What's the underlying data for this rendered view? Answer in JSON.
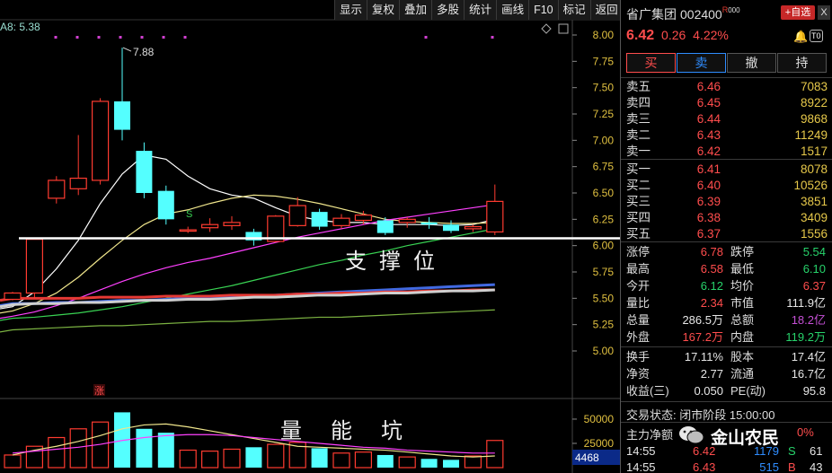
{
  "toolbar": {
    "items": [
      "显示",
      "复权",
      "叠加",
      "多股",
      "统计",
      "画线",
      "F10",
      "标记",
      "返回"
    ]
  },
  "ma_label": "A8: 5.38",
  "annotations": {
    "support": "支撑位",
    "volume_pit": "量能坑"
  },
  "stock": {
    "name": "省广集团",
    "code": "002400",
    "r_mark": "R",
    "r_code": "000",
    "select_label": "+自选",
    "close_label": "X",
    "price": "6.42",
    "change": "0.26",
    "change_pct": "4.22%",
    "t0_label": "T0"
  },
  "trade_buttons": [
    "买",
    "卖",
    "撤",
    "持"
  ],
  "asks": [
    {
      "label": "卖五",
      "price": "6.46",
      "volume": "7083"
    },
    {
      "label": "卖四",
      "price": "6.45",
      "volume": "8922"
    },
    {
      "label": "卖三",
      "price": "6.44",
      "volume": "9868"
    },
    {
      "label": "卖二",
      "price": "6.43",
      "volume": "11249"
    },
    {
      "label": "卖一",
      "price": "6.42",
      "volume": "1517"
    }
  ],
  "bids": [
    {
      "label": "买一",
      "price": "6.41",
      "volume": "8078"
    },
    {
      "label": "买二",
      "price": "6.40",
      "volume": "10526"
    },
    {
      "label": "买三",
      "price": "6.39",
      "volume": "3851"
    },
    {
      "label": "买四",
      "price": "6.38",
      "volume": "3409"
    },
    {
      "label": "买五",
      "price": "6.37",
      "volume": "1556"
    }
  ],
  "stats_a": [
    {
      "l1": "涨停",
      "v1": "6.78",
      "c1": "red",
      "l2": "跌停",
      "v2": "5.54",
      "c2": "green"
    },
    {
      "l1": "最高",
      "v1": "6.58",
      "c1": "red",
      "l2": "最低",
      "v2": "6.10",
      "c2": "green"
    },
    {
      "l1": "今开",
      "v1": "6.12",
      "c1": "green",
      "l2": "均价",
      "v2": "6.37",
      "c2": "red"
    },
    {
      "l1": "量比",
      "v1": "2.34",
      "c1": "red",
      "l2": "市值",
      "v2": "111.9亿",
      "c2": "white"
    },
    {
      "l1": "总量",
      "v1": "286.5万",
      "c1": "white",
      "l2": "总额",
      "v2": "18.2亿",
      "c2": "purple"
    },
    {
      "l1": "外盘",
      "v1": "167.2万",
      "c1": "red",
      "l2": "内盘",
      "v2": "119.2万",
      "c2": "green"
    }
  ],
  "stats_b": [
    {
      "l1": "换手",
      "v1": "17.11%",
      "c1": "white",
      "l2": "股本",
      "v2": "17.4亿",
      "c2": "white"
    },
    {
      "l1": "净资",
      "v1": "2.77",
      "c1": "white",
      "l2": "流通",
      "v2": "16.7亿",
      "c2": "white"
    },
    {
      "l1": "收益(三)",
      "v1": "0.050",
      "c1": "white",
      "l2": "PE(动)",
      "v2": "95.8",
      "c2": "white"
    }
  ],
  "trade_status": "交易状态: 闭市阶段 15:00:00",
  "main_flow": "主力净额",
  "main_flow_tail": "0%",
  "ticks": [
    {
      "time": "14:55",
      "price": "6.42",
      "vol": "1179",
      "side": "S",
      "n": "61"
    },
    {
      "time": "14:55",
      "price": "6.43",
      "vol": "515",
      "side": "B",
      "n": "43"
    }
  ],
  "watermark": "金山农民",
  "chart_data": {
    "type": "candlestick",
    "y_ticks": [
      "8.00",
      "7.75",
      "7.50",
      "7.25",
      "7.00",
      "6.75",
      "6.50",
      "6.25",
      "6.00",
      "5.75",
      "5.50",
      "5.25",
      "5.00"
    ],
    "ylim": [
      4.8,
      8.05
    ],
    "high_label": "7.88",
    "support_level": 6.07,
    "limit_up_mark": "涨",
    "s_mark": "S",
    "volume_ticks": [
      "50000",
      "25000"
    ],
    "volume_ylim": [
      0,
      62000
    ],
    "volume_current": "4468",
    "candles": [
      {
        "o": 5.49,
        "c": 5.55,
        "h": 5.56,
        "l": 5.48,
        "v": 13000
      },
      {
        "o": 5.55,
        "c": 6.06,
        "h": 6.06,
        "l": 5.5,
        "v": 22000
      },
      {
        "o": 6.45,
        "c": 6.62,
        "h": 6.66,
        "l": 6.4,
        "v": 31000
      },
      {
        "o": 6.54,
        "c": 6.64,
        "h": 7.05,
        "l": 6.48,
        "v": 40000
      },
      {
        "o": 6.62,
        "c": 7.37,
        "h": 7.4,
        "l": 6.58,
        "v": 47000
      },
      {
        "o": 7.37,
        "c": 7.1,
        "h": 7.88,
        "l": 7.0,
        "v": 57000
      },
      {
        "o": 6.9,
        "c": 6.5,
        "h": 6.98,
        "l": 6.45,
        "v": 40000
      },
      {
        "o": 6.52,
        "c": 6.25,
        "h": 6.57,
        "l": 6.2,
        "v": 36000
      },
      {
        "o": 6.14,
        "c": 6.15,
        "h": 6.18,
        "l": 6.12,
        "v": 18000
      },
      {
        "o": 6.17,
        "c": 6.2,
        "h": 6.26,
        "l": 6.13,
        "v": 17000
      },
      {
        "o": 6.19,
        "c": 6.22,
        "h": 6.28,
        "l": 6.15,
        "v": 19000
      },
      {
        "o": 6.13,
        "c": 6.05,
        "h": 6.16,
        "l": 6.0,
        "v": 21000
      },
      {
        "o": 6.04,
        "c": 6.28,
        "h": 6.29,
        "l": 6.03,
        "v": 24000
      },
      {
        "o": 6.19,
        "c": 6.38,
        "h": 6.46,
        "l": 6.18,
        "v": 26000
      },
      {
        "o": 6.32,
        "c": 6.18,
        "h": 6.35,
        "l": 6.15,
        "v": 20000
      },
      {
        "o": 6.19,
        "c": 6.26,
        "h": 6.3,
        "l": 6.16,
        "v": 15000
      },
      {
        "o": 6.24,
        "c": 6.29,
        "h": 6.33,
        "l": 6.2,
        "v": 16000
      },
      {
        "o": 6.24,
        "c": 6.12,
        "h": 6.27,
        "l": 6.1,
        "v": 13000
      },
      {
        "o": 6.22,
        "c": 6.25,
        "h": 6.27,
        "l": 6.17,
        "v": 11000
      },
      {
        "o": 6.22,
        "c": 6.2,
        "h": 6.27,
        "l": 6.16,
        "v": 9000
      },
      {
        "o": 6.2,
        "c": 6.14,
        "h": 6.24,
        "l": 6.12,
        "v": 8000
      },
      {
        "o": 6.16,
        "c": 6.18,
        "h": 6.2,
        "l": 6.13,
        "v": 12000
      },
      {
        "o": 6.13,
        "c": 6.42,
        "h": 6.58,
        "l": 6.1,
        "v": 28000
      }
    ],
    "ma_lines": [
      {
        "color": "#ffffff",
        "values": [
          5.42,
          5.56,
          5.78,
          6.05,
          6.4,
          6.68,
          6.86,
          6.82,
          6.66,
          6.54,
          6.48,
          6.45,
          6.36,
          6.28,
          6.24,
          6.22,
          6.22,
          6.2,
          6.2,
          6.2,
          6.19,
          6.2,
          6.25
        ]
      },
      {
        "color": "#f0e68c",
        "values": [
          5.38,
          5.45,
          5.55,
          5.7,
          5.88,
          6.05,
          6.2,
          6.3,
          6.34,
          6.4,
          6.45,
          6.48,
          6.47,
          6.44,
          6.4,
          6.35,
          6.3,
          6.25,
          6.23,
          6.22,
          6.21,
          6.21,
          6.22
        ]
      },
      {
        "color": "#ff40ff",
        "values": [
          5.33,
          5.37,
          5.43,
          5.5,
          5.58,
          5.66,
          5.73,
          5.79,
          5.84,
          5.88,
          5.93,
          5.98,
          6.03,
          6.08,
          6.12,
          6.16,
          6.2,
          6.24,
          6.27,
          6.3,
          6.33,
          6.36,
          6.39
        ]
      },
      {
        "color": "#39d353",
        "values": [
          5.31,
          5.32,
          5.34,
          5.36,
          5.39,
          5.42,
          5.46,
          5.5,
          5.54,
          5.58,
          5.62,
          5.67,
          5.72,
          5.77,
          5.82,
          5.86,
          5.91,
          5.95,
          6.0,
          6.04,
          6.08,
          6.12,
          6.16
        ]
      },
      {
        "color": "#4169e1",
        "values": [
          5.45,
          5.45,
          5.46,
          5.46,
          5.47,
          5.48,
          5.48,
          5.49,
          5.5,
          5.5,
          5.51,
          5.52,
          5.53,
          5.54,
          5.55,
          5.56,
          5.57,
          5.58,
          5.59,
          5.6,
          5.61,
          5.62,
          5.63
        ]
      },
      {
        "color": "#e53935",
        "values": [
          5.5,
          5.5,
          5.5,
          5.5,
          5.51,
          5.51,
          5.51,
          5.52,
          5.52,
          5.52,
          5.53,
          5.53,
          5.53,
          5.54,
          5.54,
          5.55,
          5.55,
          5.56,
          5.56,
          5.57,
          5.57,
          5.58,
          5.58
        ]
      },
      {
        "color": "#cfcfcf",
        "values": [
          5.44,
          5.45,
          5.45,
          5.46,
          5.46,
          5.47,
          5.48,
          5.48,
          5.49,
          5.49,
          5.5,
          5.51,
          5.51,
          5.52,
          5.53,
          5.53,
          5.54,
          5.55,
          5.55,
          5.56,
          5.57,
          5.57,
          5.58
        ]
      },
      {
        "color": "#7cb342",
        "values": [
          5.2,
          5.21,
          5.22,
          5.23,
          5.24,
          5.24,
          5.25,
          5.26,
          5.27,
          5.28,
          5.28,
          5.29,
          5.3,
          5.31,
          5.32,
          5.32,
          5.33,
          5.34,
          5.35,
          5.36,
          5.37,
          5.38,
          5.39
        ]
      }
    ],
    "vol_ma": [
      {
        "color": "#f0e68c",
        "values": [
          13000,
          18000,
          22000,
          27000,
          33000,
          40000,
          44000,
          45000,
          42000,
          38000,
          34000,
          30000,
          26000,
          22000,
          21000,
          20000,
          19000,
          18000,
          16000,
          14000,
          12000,
          11000,
          12000
        ]
      },
      {
        "color": "#ff40ff",
        "values": [
          15000,
          17000,
          19000,
          21000,
          24000,
          28000,
          31000,
          33000,
          34000,
          34000,
          33000,
          31000,
          29000,
          27000,
          25000,
          23000,
          21000,
          20000,
          18000,
          17000,
          16000,
          15000,
          15000
        ]
      }
    ]
  }
}
